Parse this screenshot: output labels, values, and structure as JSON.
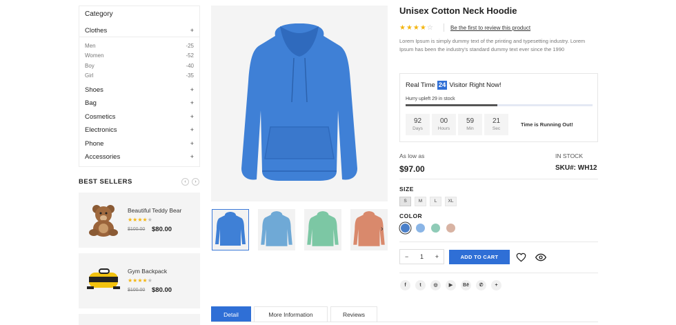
{
  "sidebar": {
    "category_title": "Category",
    "categories": [
      {
        "label": "Clothes",
        "toggle": "+"
      },
      {
        "label": "Shoes",
        "toggle": "+"
      },
      {
        "label": "Bag",
        "toggle": "+"
      },
      {
        "label": "Cosmetics",
        "toggle": "+"
      },
      {
        "label": "Electronics",
        "toggle": "+"
      },
      {
        "label": "Phone",
        "toggle": "+"
      },
      {
        "label": "Accessories",
        "toggle": "+"
      }
    ],
    "clothes_sub": [
      {
        "label": "Men",
        "count": "-25"
      },
      {
        "label": "Women",
        "count": "-52"
      },
      {
        "label": "Boy",
        "count": "-40"
      },
      {
        "label": "Girl",
        "count": "-35"
      }
    ]
  },
  "best_sellers": {
    "title": "BEST SELLERS",
    "prev": "‹",
    "next": "›",
    "items": [
      {
        "name": "Beautiful Teddy Bear",
        "old_price": "$100.00",
        "price": "$80.00",
        "rating": 4
      },
      {
        "name": "Gym Backpack",
        "old_price": "$100.00",
        "price": "$80.00",
        "rating": 4
      }
    ]
  },
  "gallery": {
    "prev": "‹",
    "next": "›"
  },
  "product": {
    "title": "Unisex Cotton Neck Hoodie",
    "rating": 4,
    "review_link": "Be the first to review this product",
    "description": "Lorem Ipsum is simply dummy text of the printing and typesetting industry. Lorem Ipsum has been the industry's standard dummy text ever since the 1990",
    "realtime": {
      "prefix": "Real Time",
      "count": "24",
      "suffix": "Visitor Right Now!",
      "stock_text": "Hurry upleft 29 in stock",
      "stock_fill_fraction": 0.49,
      "countdown": [
        {
          "num": "92",
          "label": "Days"
        },
        {
          "num": "00",
          "label": "Hours"
        },
        {
          "num": "59",
          "label": "Min"
        },
        {
          "num": "21",
          "label": "Sec"
        }
      ],
      "running": "Time is Running Out!"
    },
    "as_low_as": "As low as",
    "price": "$97.00",
    "stock": "IN STOCK",
    "sku": "SKU#: WH12",
    "size_label": "SIZE",
    "sizes": [
      "S",
      "M",
      "L",
      "XL"
    ],
    "color_label": "COLOR",
    "colors": [
      "#4a7fc9",
      "#8ab5e6",
      "#8fcbb7",
      "#d8b3a3"
    ],
    "qty": {
      "minus": "−",
      "value": "1",
      "plus": "+"
    },
    "add_to_cart": "ADD TO CART",
    "social": [
      "f",
      "t",
      "◎",
      "▶",
      "Bē",
      "✆",
      "+"
    ]
  },
  "tabs": [
    "Detail",
    "More Information",
    "Reviews"
  ],
  "colors": {
    "accent": "#2f6fd6",
    "star": "#f3b510",
    "hoodie": "#3f80d6"
  }
}
